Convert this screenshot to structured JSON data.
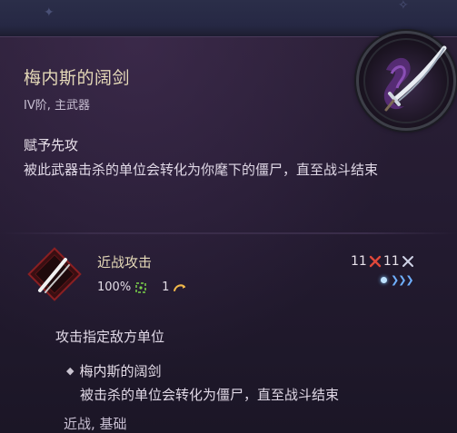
{
  "item": {
    "name": "梅内斯的阔剑",
    "subtitle": "IV阶, 主武器",
    "ability_name": "赋予先攻",
    "ability_desc": "被此武器击杀的单位会转化为你麾下的僵尸，直至战斗结束"
  },
  "skill": {
    "name": "近战攻击",
    "accuracy": "100%",
    "cost": "1",
    "damage_min": "11",
    "damage_max": "11",
    "description": "攻击指定敌方单位",
    "effect_name": "梅内斯的阔剑",
    "effect_desc": "被击杀的单位会转化为僵尸，直至战斗结束",
    "tags": "近战, 基础"
  },
  "icons": {
    "accuracy": "crosshair-icon",
    "action_point": "action-point-icon",
    "range": "range-arrows-icon"
  },
  "colors": {
    "title": "#e5d9b8",
    "accuracy_icon": "#7cd34a",
    "action_point_icon": "#f1b84a",
    "damage_icon": "#e0483a",
    "range_icon": "#6fb0ff"
  }
}
